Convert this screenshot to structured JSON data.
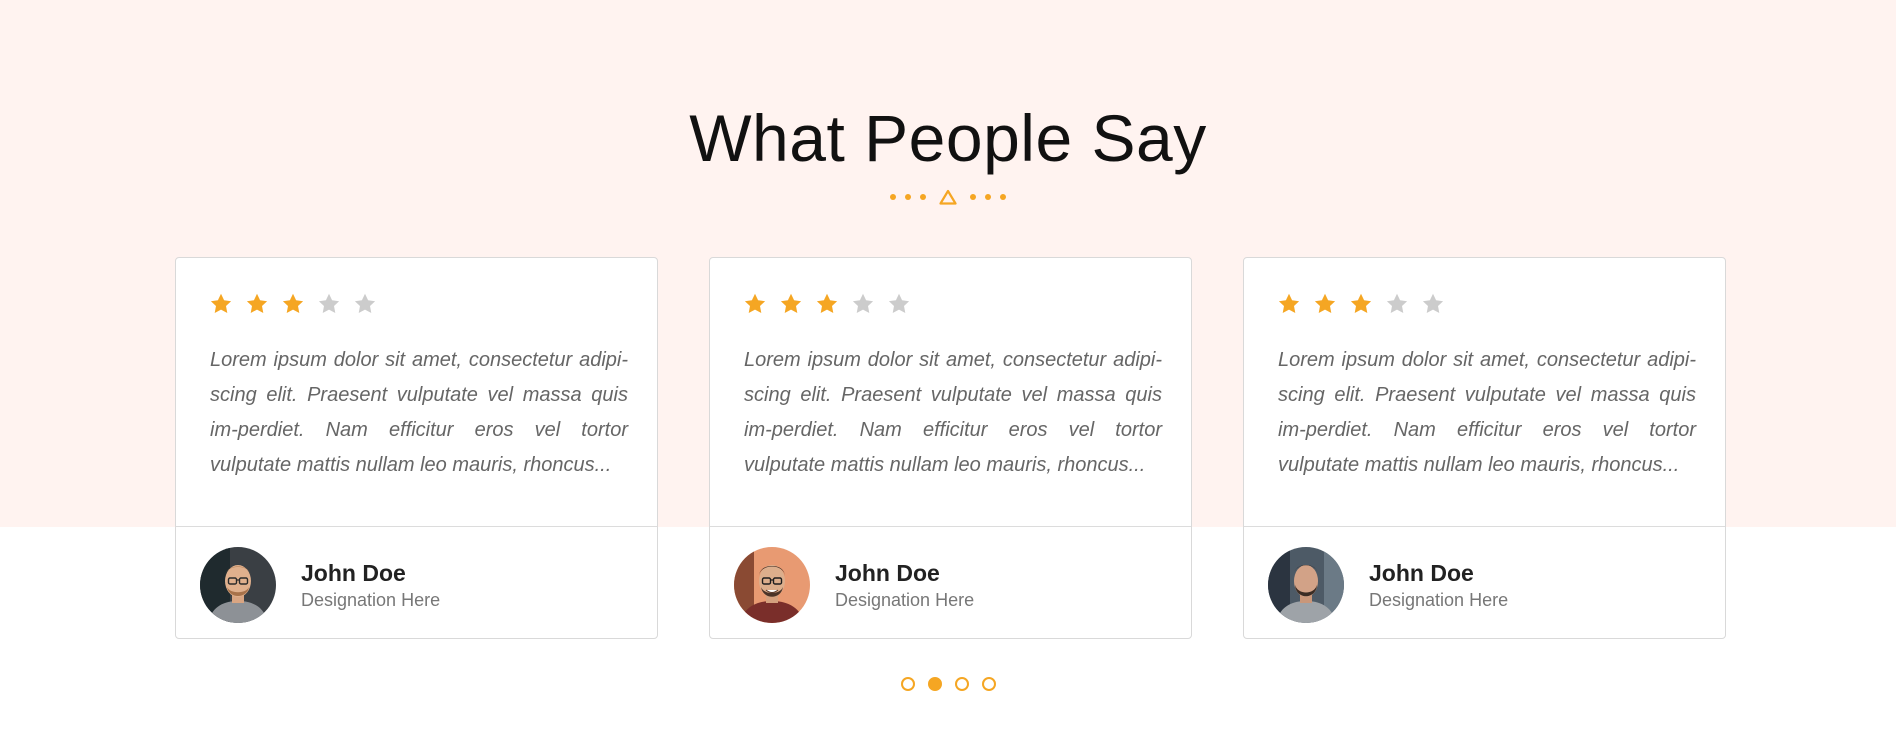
{
  "section": {
    "title": "What People Say"
  },
  "colors": {
    "accent": "#f5a623",
    "star_empty": "#cccccc",
    "band": "#fff3f0"
  },
  "testimonials": [
    {
      "rating": 3,
      "max_rating": 5,
      "quote": "Lorem ipsum dolor sit amet, consectetur adipi-scing elit. Praesent vulputate vel massa quis im-perdiet. Nam efficitur eros vel tortor vulputate mattis nullam leo mauris, rhoncus...",
      "name": "John Doe",
      "designation": "Designation Here",
      "avatar_icon": "man-glasses-avatar"
    },
    {
      "rating": 3,
      "max_rating": 5,
      "quote": "Lorem ipsum dolor sit amet, consectetur adipi-scing elit. Praesent vulputate vel massa quis im-perdiet. Nam efficitur eros vel tortor vulputate mattis nullam leo mauris, rhoncus...",
      "name": "John Doe",
      "designation": "Designation Here",
      "avatar_icon": "man-smiling-avatar"
    },
    {
      "rating": 3,
      "max_rating": 5,
      "quote": "Lorem ipsum dolor sit amet, consectetur adipi-scing elit. Praesent vulputate vel massa quis im-perdiet. Nam efficitur eros vel tortor vulputate mattis nullam leo mauris, rhoncus...",
      "name": "John Doe",
      "designation": "Designation Here",
      "avatar_icon": "man-beard-avatar"
    }
  ],
  "pagination": {
    "pages": 4,
    "active_index": 1
  }
}
